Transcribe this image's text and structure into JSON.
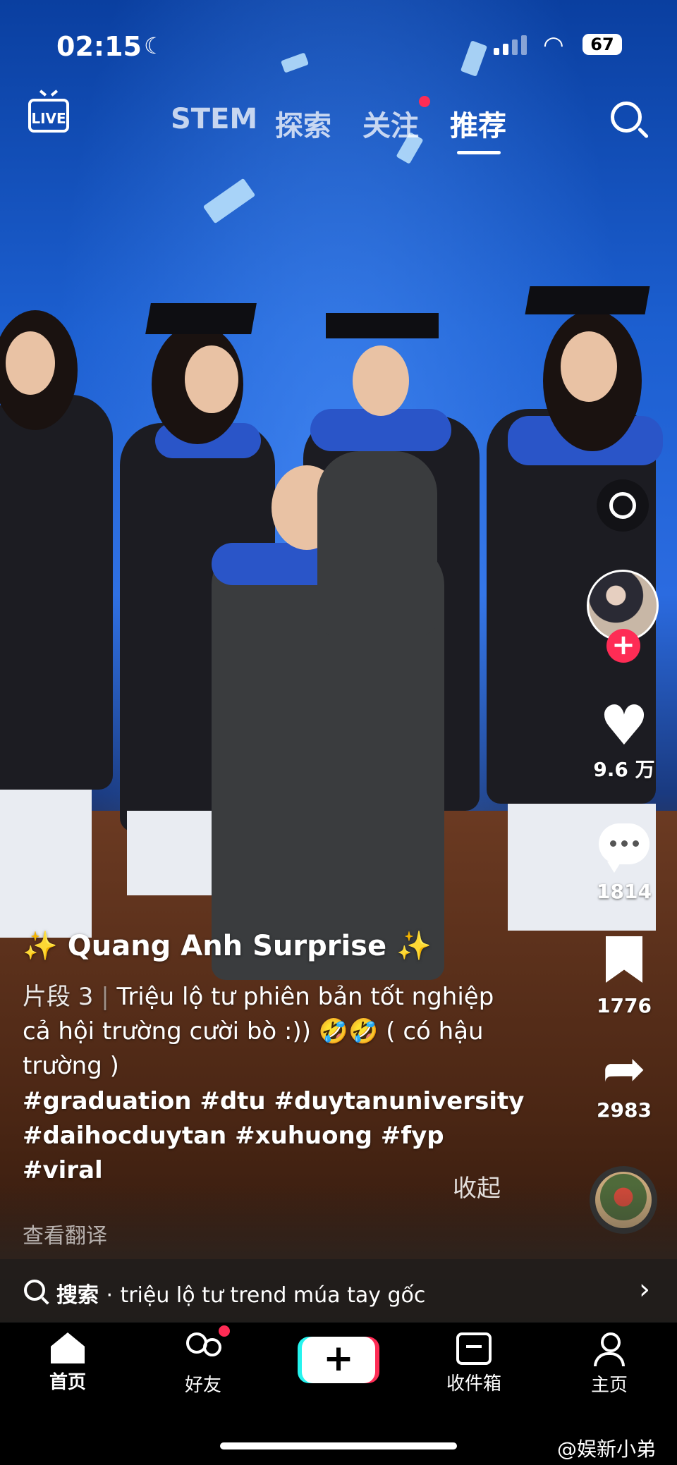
{
  "status_bar": {
    "time": "02:15",
    "battery": "67"
  },
  "top_nav": {
    "live_label": "LIVE",
    "tabs": [
      "STEM",
      "探索",
      "关注",
      "推荐"
    ],
    "active_tab": "推荐"
  },
  "video": {
    "author": "✨ Quang Anh Surprise ✨",
    "caption_segment": "片段 3",
    "caption_separator": "|",
    "caption_text": "Triệu lộ tư phiên bản tốt nghiệp cả hội trường cười bò :)) 🤣🤣 ( có hậu trường )",
    "hashtags": "#graduation #dtu #duytanuniversity #daihocduytan #xuhuong #fyp #viral",
    "collapse_label": "收起",
    "translate_label": "查看翻译"
  },
  "rail": {
    "likes": "9.6 万",
    "comments": "1814",
    "saves": "1776",
    "shares": "2983",
    "follow_symbol": "+"
  },
  "search_suggestion": {
    "prefix": "搜索",
    "dot": "·",
    "query": "triệu lộ tư trend múa tay gốc"
  },
  "bottom_nav": {
    "items": [
      "首页",
      "好友",
      "收件箱",
      "主页"
    ],
    "create_symbol": "+"
  },
  "watermark": "@娱新小弟",
  "colors": {
    "accent_red": "#fe2c55",
    "accent_cyan": "#25f4ee"
  }
}
